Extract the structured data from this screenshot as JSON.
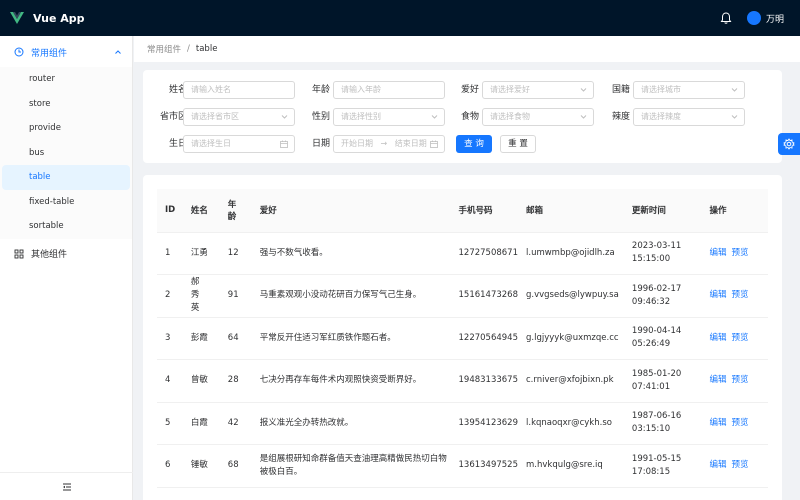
{
  "app": {
    "title": "Vue App",
    "user": "万明"
  },
  "sidebar": {
    "group1": {
      "label": "常用组件",
      "items": [
        "router",
        "store",
        "provide",
        "bus",
        "table",
        "fixed-table",
        "sortable"
      ],
      "active": "table"
    },
    "group2": {
      "label": "其他组件"
    }
  },
  "breadcrumb": {
    "parent": "常用组件",
    "separator": "/",
    "current": "table"
  },
  "filters": {
    "name": {
      "label": "姓名",
      "placeholder": "请输入姓名"
    },
    "age": {
      "label": "年龄",
      "placeholder": "请输入年龄"
    },
    "hobby": {
      "label": "爱好",
      "placeholder": "请选择爱好"
    },
    "country": {
      "label": "国籍",
      "placeholder": "请选择城市"
    },
    "region": {
      "label": "省市区",
      "placeholder": "请选择省市区"
    },
    "gender": {
      "label": "性别",
      "placeholder": "请选择性别"
    },
    "food": {
      "label": "食物",
      "placeholder": "请选择食物"
    },
    "spicy": {
      "label": "辣度",
      "placeholder": "请选择辣度"
    },
    "birthday": {
      "label": "生日",
      "placeholder": "请选择生日"
    },
    "date": {
      "label": "日期",
      "start_placeholder": "开始日期",
      "range_sep": "→",
      "end_placeholder": "结束日期"
    },
    "search_label": "查 询",
    "reset_label": "重 置"
  },
  "table": {
    "headers": {
      "id": "ID",
      "name": "姓名",
      "age": "年龄",
      "hobby": "爱好",
      "phone": "手机号码",
      "email": "邮箱",
      "updated": "更新时间",
      "actions": "操作"
    },
    "edit_label": "编辑",
    "preview_label": "预览",
    "rows": [
      {
        "id": "1",
        "name": "江勇",
        "age": "12",
        "hobby": "强与不数气收看。",
        "phone": "12727508671",
        "email": "l.umwmbp@ojidlh.za",
        "date": "2023-03-11",
        "time": "15:15:00"
      },
      {
        "id": "2",
        "name": "郝秀英",
        "age": "91",
        "hobby": "马重素观观小没动花研百力保写气己生身。",
        "phone": "15161473268",
        "email": "g.vvgseds@lywpuy.sa",
        "date": "1996-02-17",
        "time": "09:46:32"
      },
      {
        "id": "3",
        "name": "彭霞",
        "age": "64",
        "hobby": "平常反开住适习军红质铁作题石者。",
        "phone": "12270564945",
        "email": "g.lgjyyyk@uxmzqe.cc",
        "date": "1990-04-14",
        "time": "05:26:49"
      },
      {
        "id": "4",
        "name": "曾敏",
        "age": "28",
        "hobby": "七决分再存车每件术内观照快资受断界好。",
        "phone": "19483133675",
        "email": "c.rniver@xfojbixn.pk",
        "date": "1985-01-20",
        "time": "07:41:01"
      },
      {
        "id": "5",
        "name": "白霞",
        "age": "42",
        "hobby": "报义准光全办转热改就。",
        "phone": "13954123629",
        "email": "l.kqnaoqxr@cykh.so",
        "date": "1987-06-16",
        "time": "03:15:10"
      },
      {
        "id": "6",
        "name": "锤敏",
        "age": "68",
        "hobby": "是组展根研知命群备值天查油理高精做民热切白物被极白百。",
        "phone": "13613497525",
        "email": "m.hvkqulg@sre.iq",
        "date": "1991-05-15",
        "time": "17:08:15"
      }
    ]
  },
  "colors": {
    "primary": "#1677ff",
    "header_bg": "#001529"
  }
}
